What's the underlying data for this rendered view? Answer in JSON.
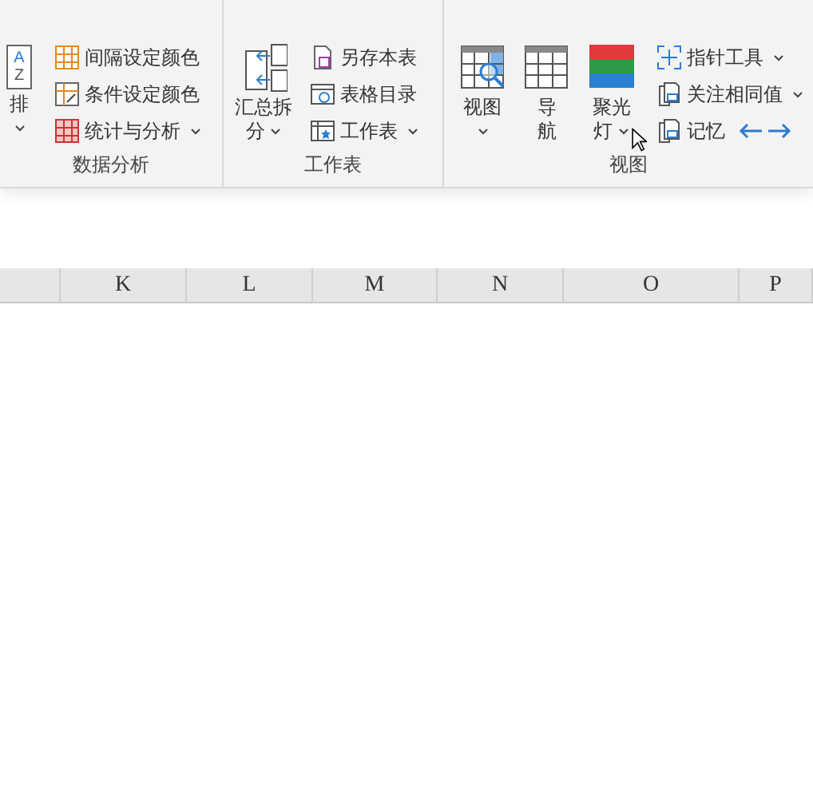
{
  "ribbon": {
    "groups": [
      {
        "label": "数据分析",
        "large_buttons": [
          {
            "lines": [
              "排"
            ],
            "dropdown": true,
            "icon_letters": [
              "A",
              "Z"
            ]
          }
        ],
        "small_buttons": [
          {
            "label": "间隔设定颜色",
            "dropdown": false
          },
          {
            "label": "条件设定颜色",
            "dropdown": false
          },
          {
            "label": "统计与分析",
            "dropdown": true
          }
        ]
      },
      {
        "label": "工作表",
        "large_buttons": [
          {
            "lines": [
              "汇总拆",
              "分"
            ],
            "dropdown": true
          }
        ],
        "small_buttons": [
          {
            "label": "另存本表",
            "dropdown": false
          },
          {
            "label": "表格目录",
            "dropdown": false
          },
          {
            "label": "工作表",
            "dropdown": true
          }
        ]
      },
      {
        "label": "视图",
        "large_buttons": [
          {
            "lines": [
              "视图"
            ],
            "dropdown": true
          },
          {
            "lines": [
              "导",
              "航"
            ],
            "dropdown": false
          },
          {
            "lines": [
              "聚光",
              "灯"
            ],
            "dropdown": true
          }
        ],
        "small_buttons": [
          {
            "label": "指针工具",
            "dropdown": true
          },
          {
            "label": "关注相同值",
            "dropdown": true
          },
          {
            "label": "记忆",
            "dropdown": false,
            "arrows": true
          }
        ]
      }
    ]
  },
  "sheet": {
    "columns": [
      "",
      "K",
      "L",
      "M",
      "N",
      "O",
      "P"
    ]
  }
}
